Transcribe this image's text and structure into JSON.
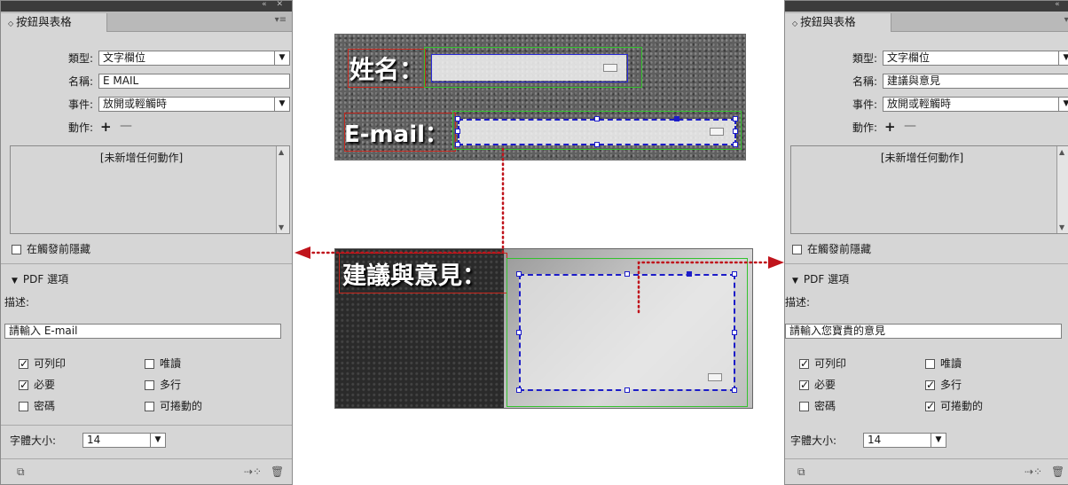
{
  "left_panel": {
    "tab_title": "按鈕與表格",
    "type_label": "類型:",
    "type_value": "文字欄位",
    "name_label": "名稱:",
    "name_value": "E MAIL",
    "event_label": "事件:",
    "event_value": "放開或輕觸時",
    "action_label": "動作:",
    "actions_empty": "[未新增任何動作]",
    "hide_label": "在觸發前隱藏",
    "pdf_section": "PDF 選項",
    "desc_label": "描述:",
    "desc_value": "請輸入 E-mail",
    "checkboxes": [
      {
        "label": "可列印",
        "checked": true
      },
      {
        "label": "唯讀",
        "checked": false
      },
      {
        "label": "必要",
        "checked": true
      },
      {
        "label": "多行",
        "checked": false
      },
      {
        "label": "密碼",
        "checked": false
      },
      {
        "label": "可捲動的",
        "checked": false
      }
    ],
    "font_size_label": "字體大小:",
    "font_size_value": "14"
  },
  "right_panel": {
    "tab_title": "按鈕與表格",
    "type_label": "類型:",
    "type_value": "文字欄位",
    "name_label": "名稱:",
    "name_value": "建議與意見",
    "event_label": "事件:",
    "event_value": "放開或輕觸時",
    "action_label": "動作:",
    "actions_empty": "[未新增任何動作]",
    "hide_label": "在觸發前隱藏",
    "pdf_section": "PDF 選項",
    "desc_label": "描述:",
    "desc_value": "請輸入您寶貴的意見",
    "checkboxes": [
      {
        "label": "可列印",
        "checked": true
      },
      {
        "label": "唯讀",
        "checked": false
      },
      {
        "label": "必要",
        "checked": true
      },
      {
        "label": "多行",
        "checked": true
      },
      {
        "label": "密碼",
        "checked": false
      },
      {
        "label": "可捲動的",
        "checked": true
      }
    ],
    "font_size_label": "字體大小:",
    "font_size_value": "14"
  },
  "top_image": {
    "name_text": "姓名：",
    "email_text": "E-mail："
  },
  "bottom_image": {
    "comment_text": "建議與意見："
  },
  "colors": {
    "arrow": "#c0141c",
    "label_frame": "#c8281e",
    "field_frame": "#33c22e",
    "selection": "#1c1cc8"
  }
}
